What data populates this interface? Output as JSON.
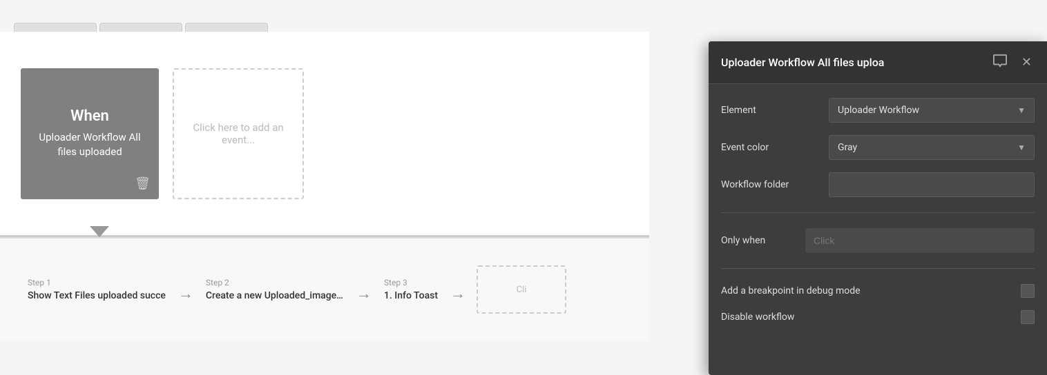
{
  "tabs": [
    {
      "id": "tab1",
      "label": ""
    },
    {
      "id": "tab2",
      "label": ""
    },
    {
      "id": "tab3",
      "label": ""
    }
  ],
  "when_block": {
    "title": "When",
    "subtitle": "Uploader Workflow All files uploaded",
    "trash_icon": "🗑"
  },
  "add_event": {
    "label": "Click here to add an event..."
  },
  "steps": [
    {
      "id": "step1",
      "step_label": "Step 1",
      "title": "Show Text Files uploaded succe"
    },
    {
      "id": "step2",
      "step_label": "Step 2",
      "title": "Create a new Uploaded_image..."
    },
    {
      "id": "step3",
      "step_label": "Step 3",
      "title": "1. Info Toast"
    },
    {
      "id": "step4",
      "step_label": "",
      "title": "Cli"
    }
  ],
  "panel": {
    "title": "Uploader Workflow All files uploa",
    "comment_icon": "💬",
    "close_icon": "✕",
    "fields": {
      "element": {
        "label": "Element",
        "value": "Uploader Workflow"
      },
      "event_color": {
        "label": "Event color",
        "value": "Gray"
      },
      "workflow_folder": {
        "label": "Workflow folder",
        "value": ""
      },
      "only_when": {
        "label": "Only when",
        "placeholder": "Click"
      }
    },
    "breakpoint": {
      "label": "Add a breakpoint in debug mode"
    },
    "disable": {
      "label": "Disable workflow"
    }
  }
}
